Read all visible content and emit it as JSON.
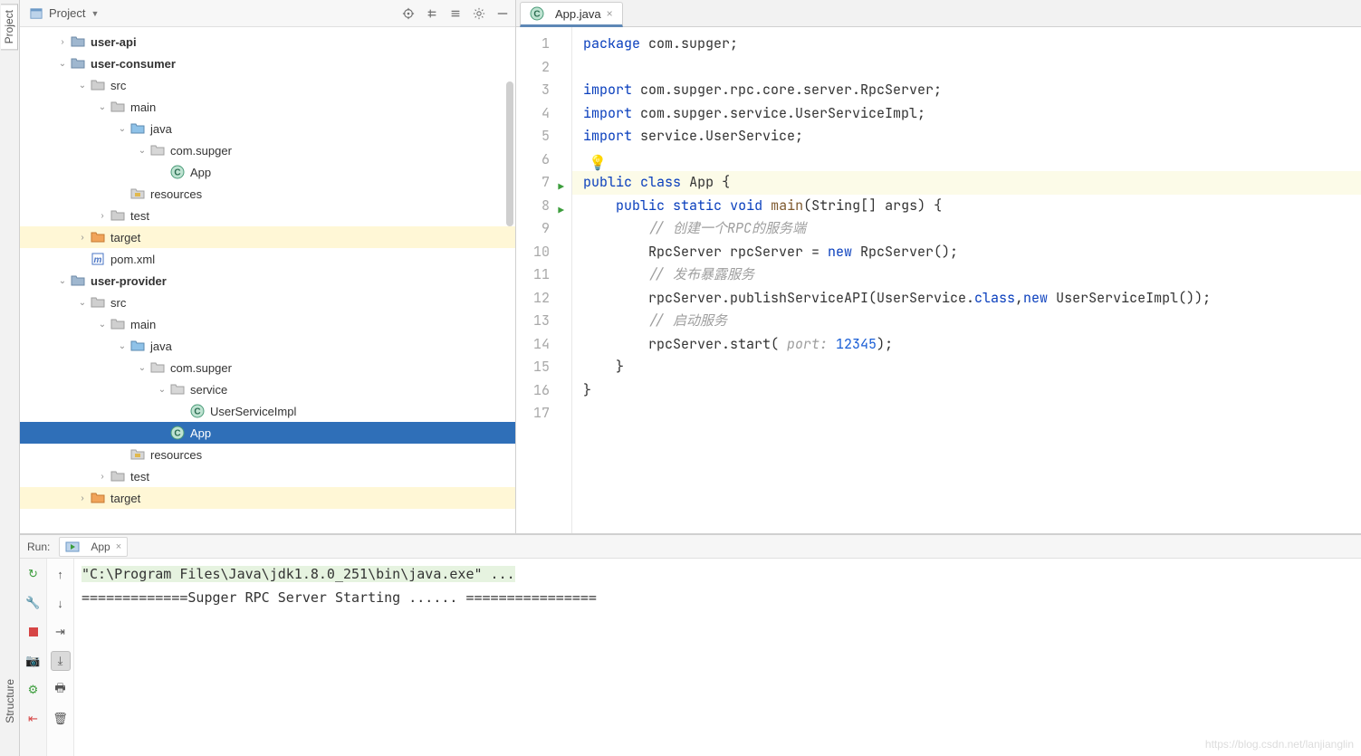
{
  "left_rail": {
    "project_label": "Project",
    "structure_label": "Structure"
  },
  "project_header": {
    "title": "Project"
  },
  "tree": [
    {
      "depth": 1,
      "expand": ">",
      "icon": "module",
      "label": "user-api",
      "bold": true
    },
    {
      "depth": 1,
      "expand": "v",
      "icon": "module",
      "label": "user-consumer",
      "bold": true
    },
    {
      "depth": 2,
      "expand": "v",
      "icon": "folder",
      "label": "src"
    },
    {
      "depth": 3,
      "expand": "v",
      "icon": "folder",
      "label": "main"
    },
    {
      "depth": 4,
      "expand": "v",
      "icon": "src",
      "label": "java"
    },
    {
      "depth": 5,
      "expand": "v",
      "icon": "pkg",
      "label": "com.supger"
    },
    {
      "depth": 6,
      "expand": "",
      "icon": "class",
      "label": "App"
    },
    {
      "depth": 4,
      "expand": "",
      "icon": "res",
      "label": "resources"
    },
    {
      "depth": 3,
      "expand": ">",
      "icon": "folder",
      "label": "test"
    },
    {
      "depth": 2,
      "expand": ">",
      "icon": "target",
      "label": "target",
      "hl": true
    },
    {
      "depth": 2,
      "expand": "",
      "icon": "maven",
      "label": "pom.xml"
    },
    {
      "depth": 1,
      "expand": "v",
      "icon": "module",
      "label": "user-provider",
      "bold": true
    },
    {
      "depth": 2,
      "expand": "v",
      "icon": "folder",
      "label": "src"
    },
    {
      "depth": 3,
      "expand": "v",
      "icon": "folder",
      "label": "main"
    },
    {
      "depth": 4,
      "expand": "v",
      "icon": "src",
      "label": "java"
    },
    {
      "depth": 5,
      "expand": "v",
      "icon": "pkg",
      "label": "com.supger"
    },
    {
      "depth": 6,
      "expand": "v",
      "icon": "pkg",
      "label": "service"
    },
    {
      "depth": 7,
      "expand": "",
      "icon": "class",
      "label": "UserServiceImpl"
    },
    {
      "depth": 6,
      "expand": "",
      "icon": "class",
      "label": "App",
      "selected": true
    },
    {
      "depth": 4,
      "expand": "",
      "icon": "res",
      "label": "resources"
    },
    {
      "depth": 3,
      "expand": ">",
      "icon": "folder",
      "label": "test"
    },
    {
      "depth": 2,
      "expand": ">",
      "icon": "target",
      "label": "target",
      "hl": true
    }
  ],
  "editor": {
    "tab_label": "App.java",
    "lines": [
      {
        "n": 1,
        "html": "<span class='kw'>package</span> com.supger;"
      },
      {
        "n": 2,
        "html": ""
      },
      {
        "n": 3,
        "html": "<span class='kw'>import</span> com.supger.rpc.core.server.RpcServer;"
      },
      {
        "n": 4,
        "html": "<span class='kw'>import</span> com.supger.service.UserServiceImpl;"
      },
      {
        "n": 5,
        "html": "<span class='kw'>import</span> service.UserService;"
      },
      {
        "n": 6,
        "html": ""
      },
      {
        "n": 7,
        "run": true,
        "hl": true,
        "html": "<span class='kw'>public</span> <span class='kw'>class</span> <span class='cls'>App</span> {"
      },
      {
        "n": 8,
        "run": true,
        "html": "    <span class='kw'>public</span> <span class='kw'>static</span> <span class='kw'>void</span> <span class='fn'>main</span>(String[] args) {"
      },
      {
        "n": 9,
        "html": "        <span class='cmt'>// 创建一个RPC的服务端</span>"
      },
      {
        "n": 10,
        "html": "        RpcServer rpcServer = <span class='kw'>new</span> RpcServer();"
      },
      {
        "n": 11,
        "html": "        <span class='cmt'>// 发布暴露服务</span>"
      },
      {
        "n": 12,
        "html": "        rpcServer.publishServiceAPI(UserService.<span class='kw'>class</span>,<span class='kw'>new</span> UserServiceImpl());"
      },
      {
        "n": 13,
        "html": "        <span class='cmt'>// 启动服务</span>"
      },
      {
        "n": 14,
        "html": "        rpcServer.start( <span class='hint'>port:</span> <span class='num'>12345</span>);"
      },
      {
        "n": 15,
        "html": "    }"
      },
      {
        "n": 16,
        "html": "}"
      },
      {
        "n": 17,
        "html": ""
      }
    ]
  },
  "run": {
    "label": "Run:",
    "config": "App",
    "console_cmd": "\"C:\\Program Files\\Java\\jdk1.8.0_251\\bin\\java.exe\" ...",
    "console_line2": "=============Supger RPC Server Starting ...... ================"
  },
  "watermark": "https://blog.csdn.net/lanjianglin"
}
